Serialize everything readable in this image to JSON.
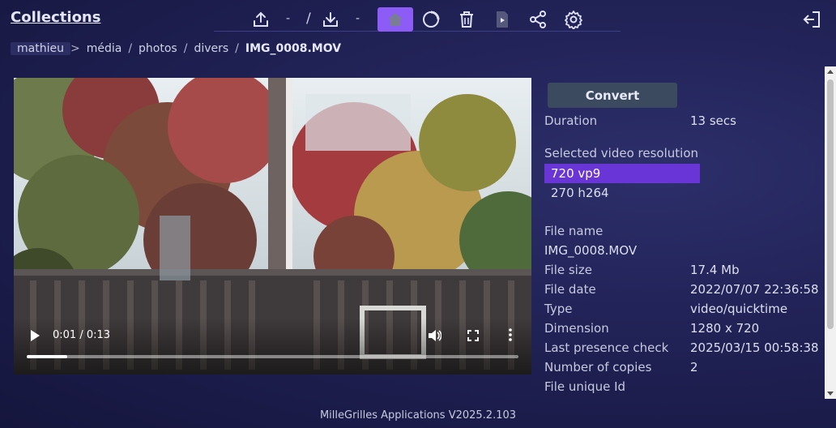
{
  "header": {
    "title": "Collections",
    "toolbar": {
      "upload_sep": "-",
      "slash_sep": "/",
      "download_sep": "-",
      "icons": [
        "upload-icon",
        "download-icon",
        "home-icon",
        "refresh-icon",
        "trash-icon",
        "video-file-icon",
        "share-icon",
        "settings-icon"
      ],
      "active_color": "#8d5cf6"
    },
    "exit_icon": "logout-icon"
  },
  "breadcrumb": {
    "items": [
      "mathieu",
      "média",
      "photos",
      "divers"
    ],
    "separators": [
      ">",
      "/",
      "/",
      "/"
    ],
    "current": "IMG_0008.MOV"
  },
  "video": {
    "time": "0:01 / 0:13",
    "progress_fraction": 0.083,
    "icons": [
      "play-icon",
      "volume-icon",
      "fullscreen-icon",
      "more-icon"
    ]
  },
  "details": {
    "convert_label": "Convert",
    "duration_label": "Duration",
    "duration_value": "13 secs",
    "resolution_label": "Selected video resolution",
    "resolutions": [
      "720 vp9",
      "270 h264"
    ],
    "selected_color": "#6a35d6",
    "file_name_label": "File name",
    "file_name_value": "IMG_0008.MOV",
    "file_size_label": "File size",
    "file_size_value": "17.4 Mb",
    "file_date_label": "File date",
    "file_date_value": "2022/07/07 22:36:58",
    "type_label": "Type",
    "type_value": "video/quicktime",
    "dimension_label": "Dimension",
    "dimension_value": "1280 x 720",
    "presence_label": "Last presence check",
    "presence_value": "2025/03/15 00:58:38",
    "copies_label": "Number of copies",
    "copies_value": "2",
    "unique_id_label": "File unique Id"
  },
  "footer": {
    "text": "MilleGrilles Applications V2025.2.103"
  }
}
